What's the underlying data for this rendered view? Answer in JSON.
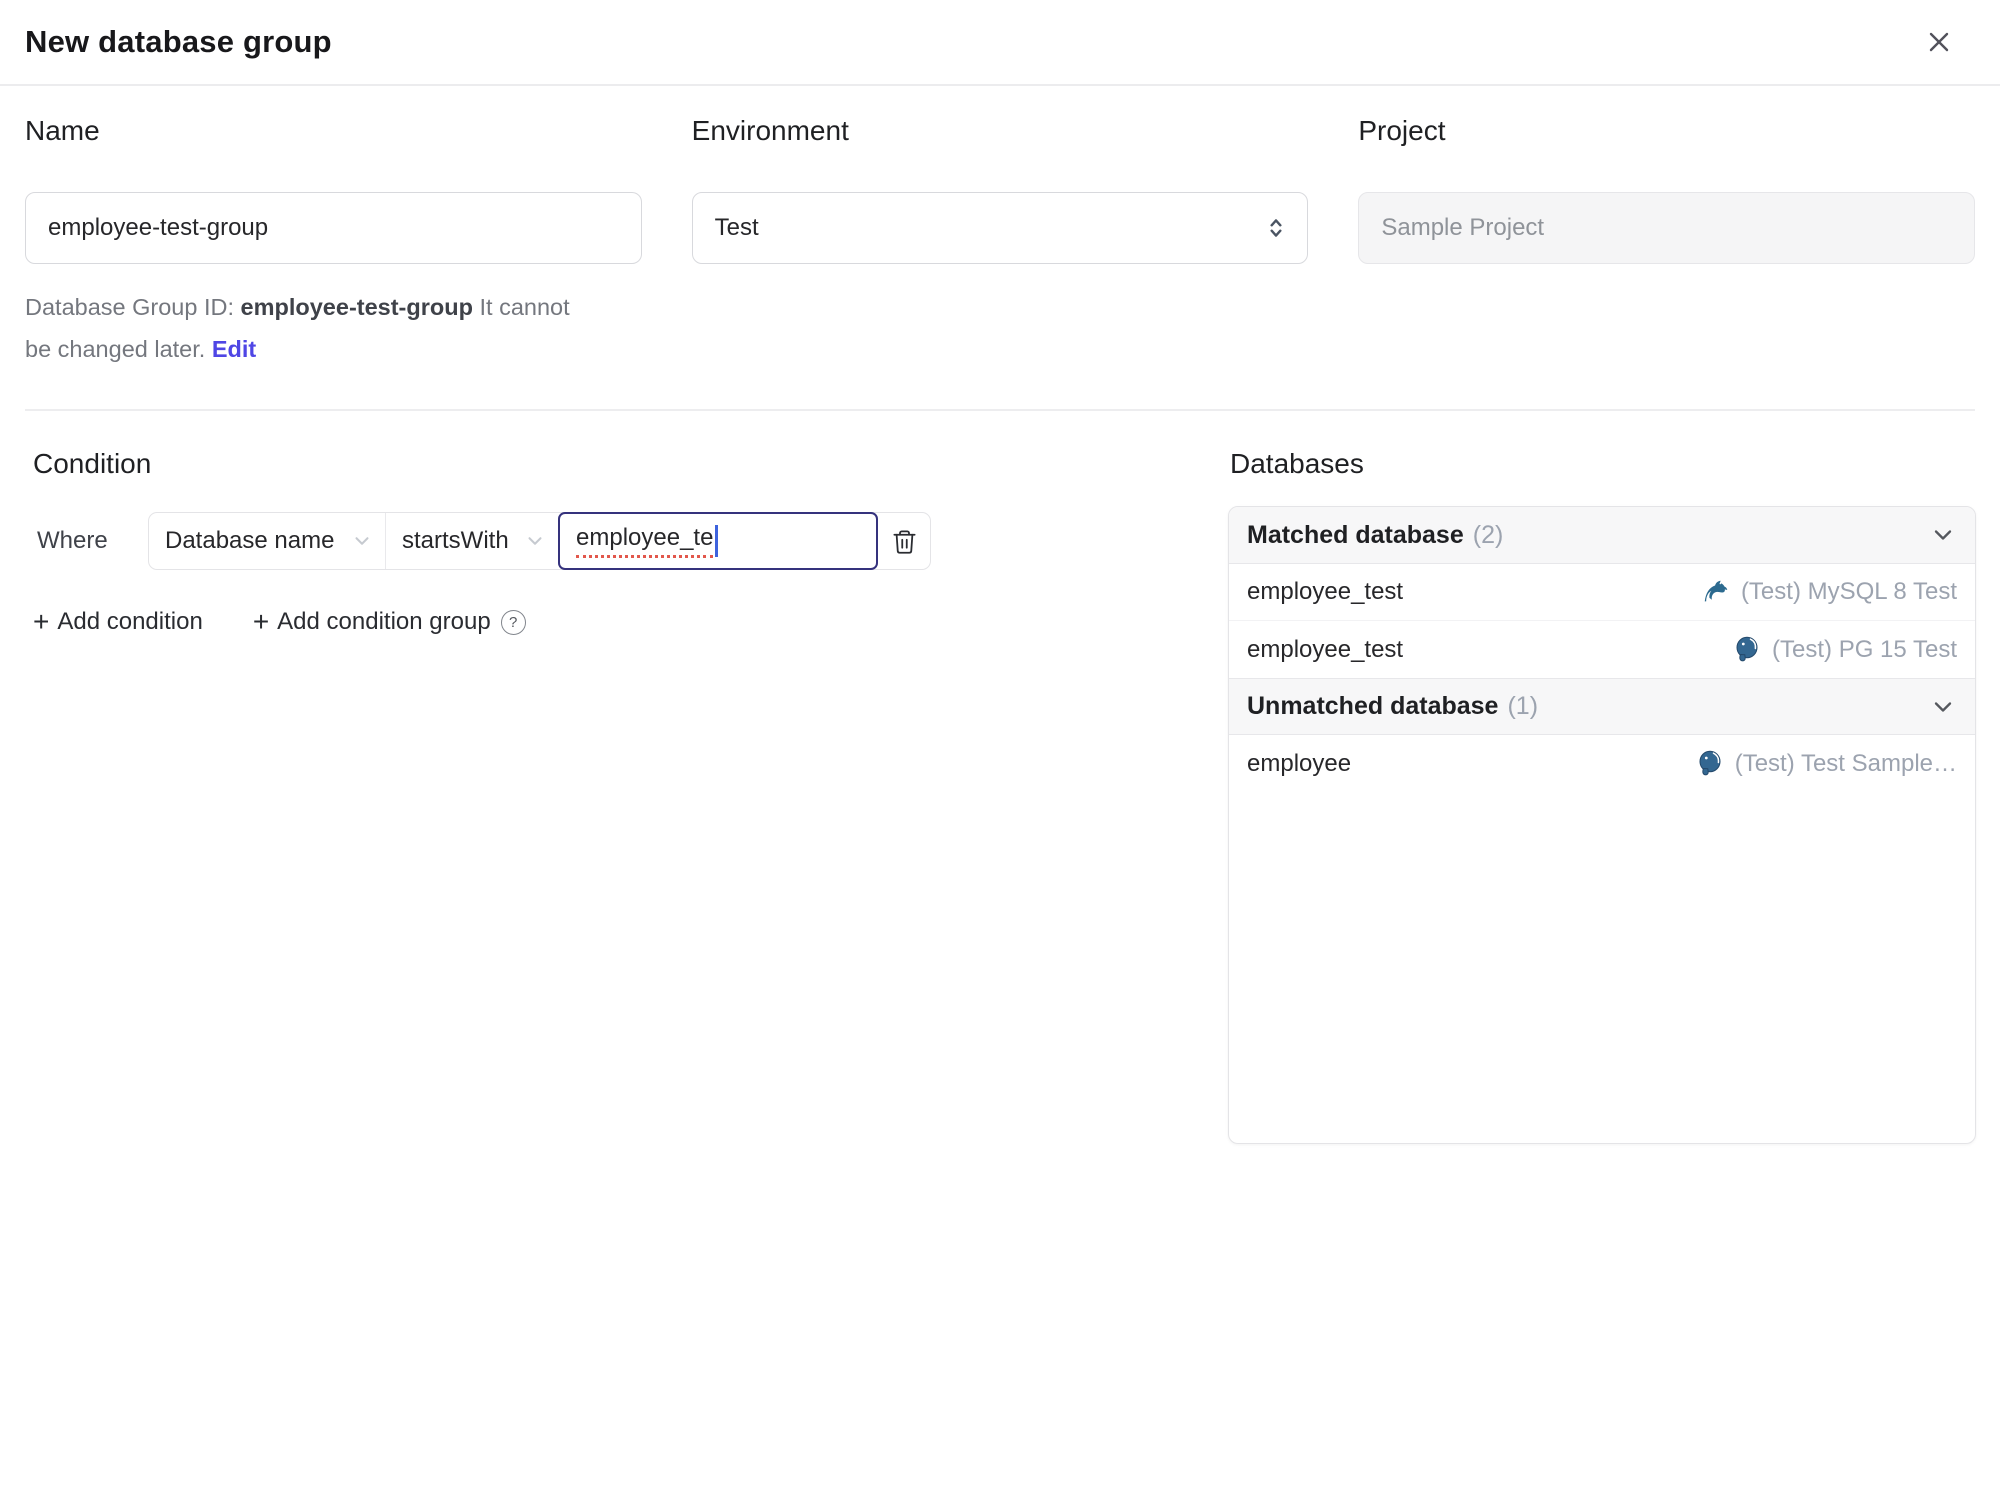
{
  "dialog": {
    "title": "New database group"
  },
  "form": {
    "name_label": "Name",
    "name_value": "employee-test-group",
    "environment_label": "Environment",
    "environment_value": "Test",
    "project_label": "Project",
    "project_value": "Sample Project",
    "id_note_prefix": "Database Group ID:",
    "id_note_id": "employee-test-group",
    "id_note_suffix": "It cannot be changed later.",
    "edit_label": "Edit"
  },
  "condition": {
    "heading": "Condition",
    "where_label": "Where",
    "field_value": "Database name",
    "operator_value": "startsWith",
    "value_text": "employee_te",
    "add_condition": "Add condition",
    "add_condition_group": "Add condition group",
    "plus": "+",
    "help": "?"
  },
  "databases": {
    "heading": "Databases",
    "matched": {
      "title": "Matched database",
      "count": "(2)"
    },
    "unmatched": {
      "title": "Unmatched database",
      "count": "(1)"
    },
    "rows": [
      {
        "name": "employee_test",
        "engine": "mysql",
        "instance": "(Test) MySQL 8 Test"
      },
      {
        "name": "employee_test",
        "engine": "postgres",
        "instance": "(Test) PG 15 Test"
      },
      {
        "name": "employee",
        "engine": "postgres",
        "instance": "(Test) Test Sample…"
      }
    ]
  },
  "colors": {
    "accent": "#4f46e5",
    "focus_border": "#35327d",
    "mysql_teal": "#2c6a8f",
    "postgres_blue": "#336791",
    "spellcheck_red": "#e2574c"
  }
}
